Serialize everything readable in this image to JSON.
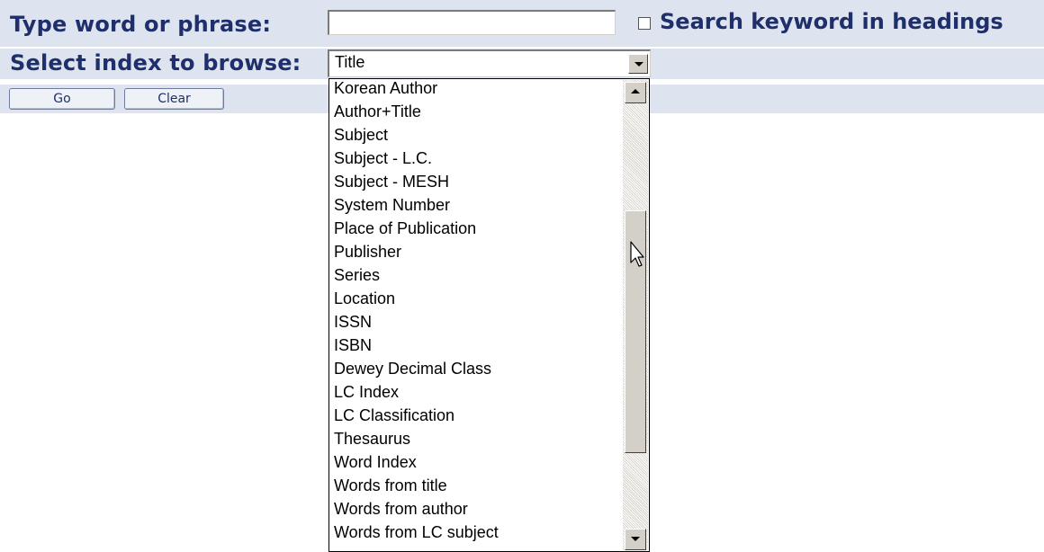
{
  "form": {
    "word_label": "Type word or phrase:",
    "word_value": "",
    "heading_checkbox_label": "Search keyword in headings",
    "heading_checked": false,
    "index_label": "Select index to browse:",
    "index_selected": "Title",
    "go_label": "Go",
    "clear_label": "Clear"
  },
  "dropdown": {
    "options": [
      "Korean Author",
      "Author+Title",
      "Subject",
      "Subject - L.C.",
      "Subject - MESH",
      "System Number",
      "Place of Publication",
      "Publisher",
      "Series",
      "Location",
      "ISSN",
      "ISBN",
      "Dewey Decimal Class",
      "LC Index",
      "LC Classification",
      "Thesaurus",
      "Word Index",
      "Words from title",
      "Words from author",
      "Words from LC subject"
    ]
  },
  "colors": {
    "label_text": "#1f2f6b",
    "row_background": "#dde4ef"
  },
  "icons": {
    "cursor": "arrow-pointer-icon",
    "dropdown_arrow": "chevron-down-icon",
    "scroll_up": "scroll-up-arrow-icon",
    "scroll_down": "scroll-down-arrow-icon"
  }
}
